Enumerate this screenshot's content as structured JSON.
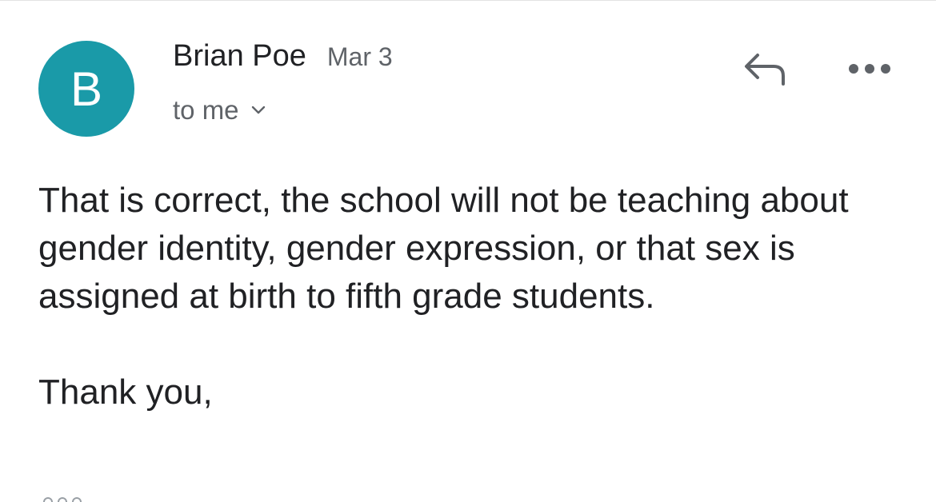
{
  "message": {
    "sender": {
      "avatar_letter": "B",
      "avatar_color": "#1a9aa8",
      "name": "Brian Poe",
      "date": "Mar 3"
    },
    "recipient_label": "to me",
    "actions": {
      "reply_icon": "reply-icon",
      "more_icon": "more-horiz-icon",
      "expand_icon": "chevron-down-icon"
    },
    "body": {
      "paragraph_1": "That is correct, the school will not be teaching about gender identity, gender expression, or that sex is assigned at birth to fifth grade students.",
      "paragraph_2": "Thank you,"
    },
    "trimmed_content_icon": "show-trimmed-content-icon"
  }
}
